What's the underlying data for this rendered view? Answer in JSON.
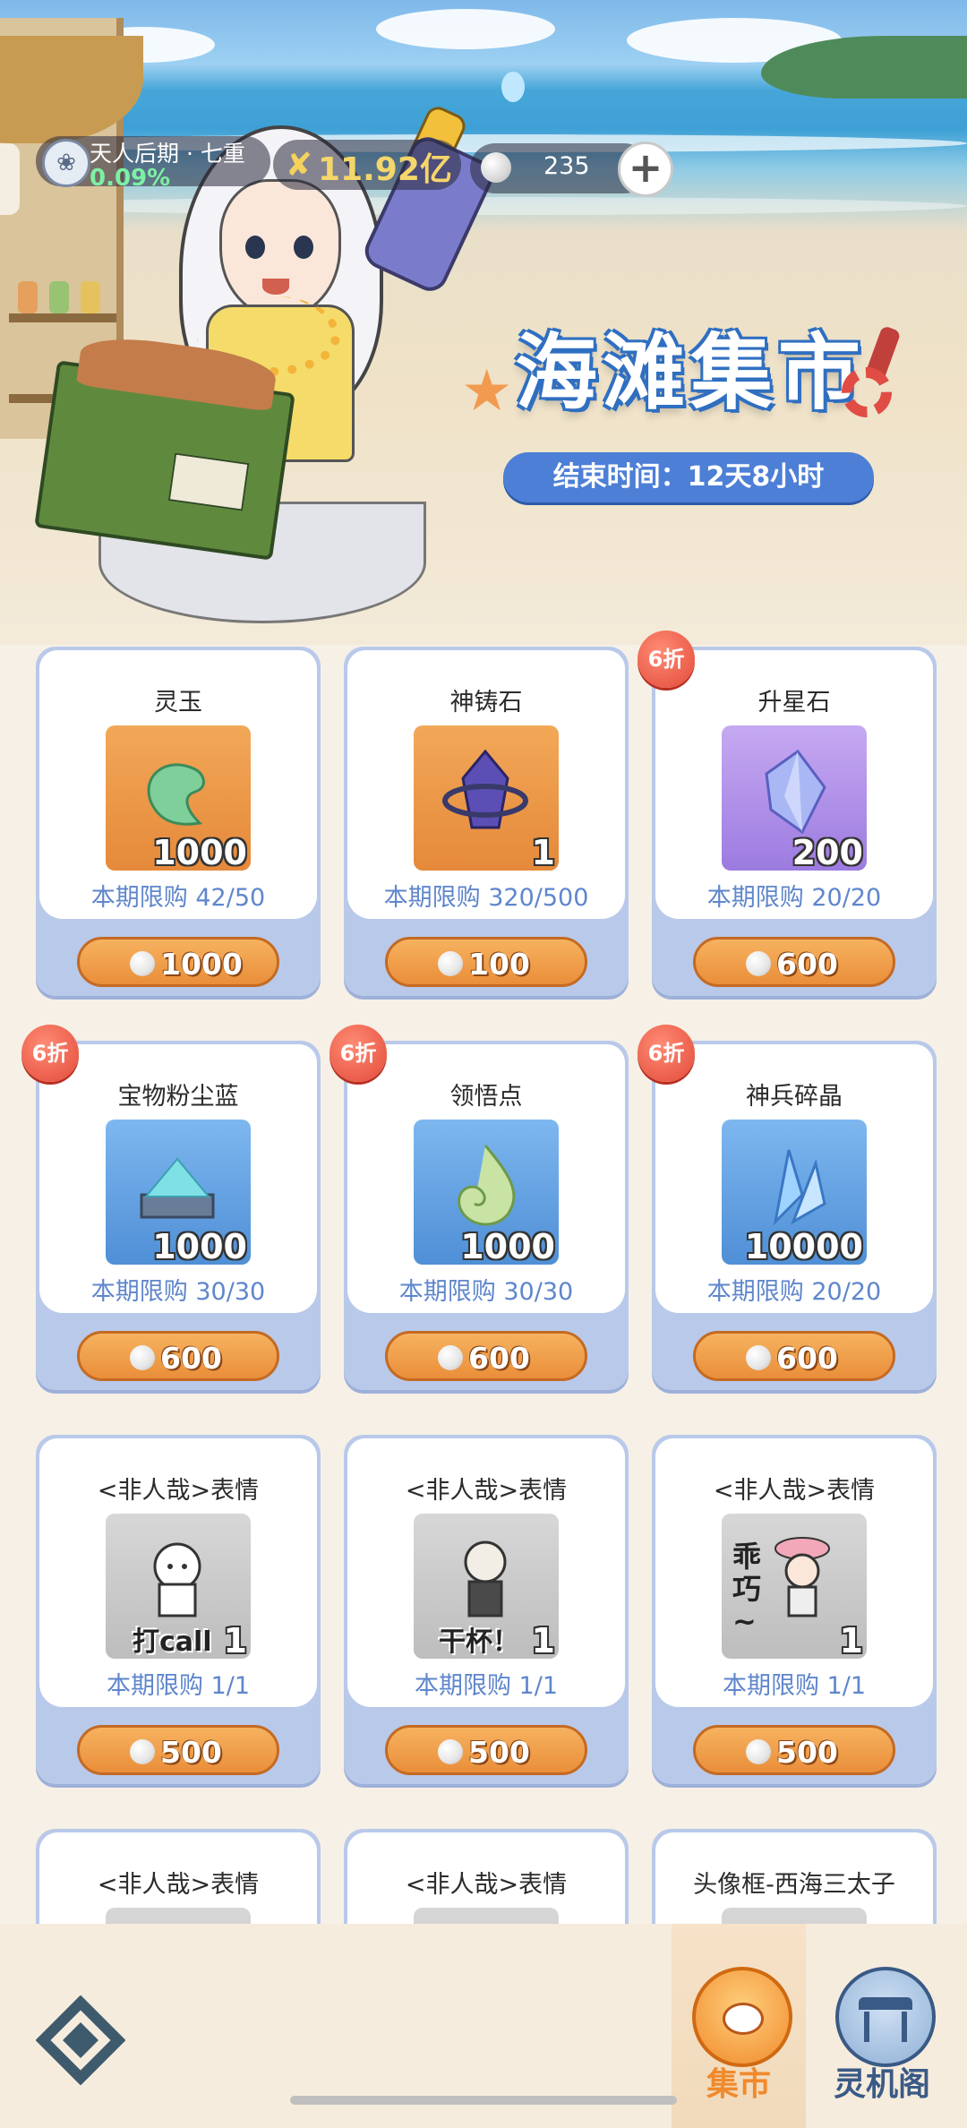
{
  "header": {
    "rank_title": "天人后期 · 七重",
    "rank_progress": "0.09%",
    "power_value": "11.92亿",
    "currency_value": "235"
  },
  "event": {
    "title": "海滩集市",
    "end_time": "结束时间：12天8小时"
  },
  "shop_items": [
    {
      "name": "灵玉",
      "qty": "1000",
      "limit": "本期限购 42/50",
      "price": "1000",
      "discount": "",
      "tile": "orange"
    },
    {
      "name": "神铸石",
      "qty": "1",
      "limit": "本期限购 320/500",
      "price": "100",
      "discount": "",
      "tile": "orange"
    },
    {
      "name": "升星石",
      "qty": "200",
      "limit": "本期限购 20/20",
      "price": "600",
      "discount": "6折",
      "tile": "purple"
    },
    {
      "name": "宝物粉尘蓝",
      "qty": "1000",
      "limit": "本期限购 30/30",
      "price": "600",
      "discount": "6折",
      "tile": "blue"
    },
    {
      "name": "领悟点",
      "qty": "1000",
      "limit": "本期限购 30/30",
      "price": "600",
      "discount": "6折",
      "tile": "blue"
    },
    {
      "name": "神兵碎晶",
      "qty": "10000",
      "limit": "本期限购 20/20",
      "price": "600",
      "discount": "6折",
      "tile": "blue"
    },
    {
      "name": "<非人哉>表情",
      "qty": "1",
      "limit": "本期限购 1/1",
      "price": "500",
      "discount": "",
      "tile": "grey",
      "sticker_text": "打call"
    },
    {
      "name": "<非人哉>表情",
      "qty": "1",
      "limit": "本期限购 1/1",
      "price": "500",
      "discount": "",
      "tile": "grey",
      "sticker_text": "干杯！"
    },
    {
      "name": "<非人哉>表情",
      "qty": "1",
      "limit": "本期限购 1/1",
      "price": "500",
      "discount": "",
      "tile": "grey",
      "sticker_text": "乖巧~"
    },
    {
      "name": "<非人哉>表情",
      "qty": "",
      "limit": "",
      "price": "",
      "discount": "",
      "tile": "grey"
    },
    {
      "name": "<非人哉>表情",
      "qty": "",
      "limit": "",
      "price": "",
      "discount": "",
      "tile": "grey"
    },
    {
      "name": "头像框-西海三太子",
      "qty": "",
      "limit": "",
      "price": "",
      "discount": "",
      "tile": "grey"
    }
  ],
  "nav": {
    "tabs": [
      {
        "label": "集市",
        "icon": "market-icon",
        "active": true,
        "color": "#f08a2c"
      },
      {
        "label": "灵机阁",
        "icon": "pavilion-icon",
        "active": false,
        "color": "#3a5a86"
      }
    ],
    "left_icon": "diamond-logo-icon"
  }
}
